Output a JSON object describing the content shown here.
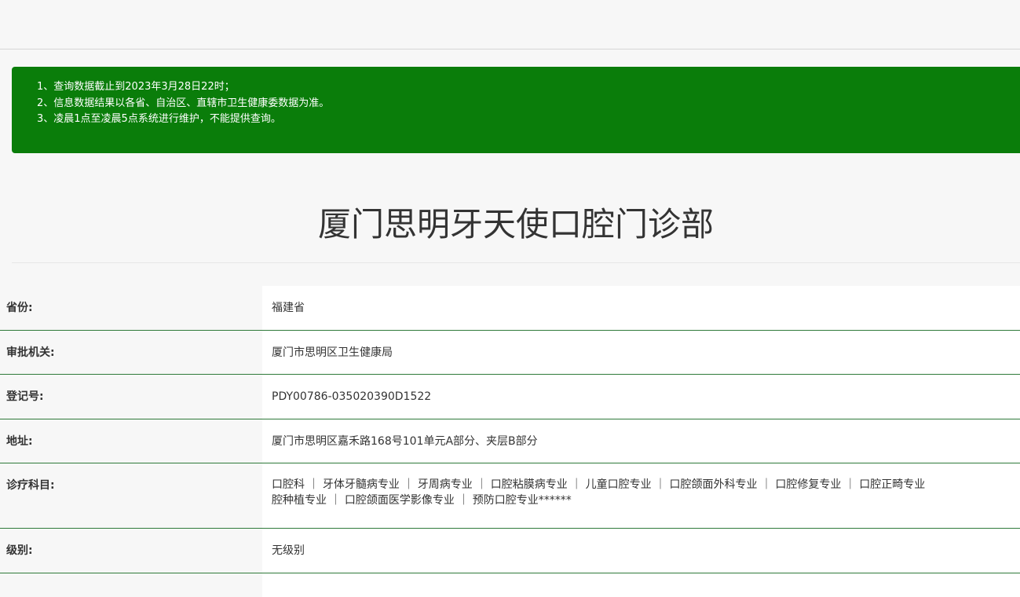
{
  "notice": {
    "lines": [
      "1、查询数据截止到2023年3月28日22时；",
      "2、信息数据结果以各省、自治区、直辖市卫生健康委数据为准。",
      "3、凌晨1点至凌晨5点系统进行维护，不能提供查询。"
    ],
    "background_color": "#0a7d0a"
  },
  "title": "厦门思明牙天使口腔门诊部",
  "details": {
    "province": {
      "label": "省份:",
      "value": "福建省"
    },
    "authority": {
      "label": "审批机关:",
      "value": "厦门市思明区卫生健康局"
    },
    "registration": {
      "label": "登记号:",
      "value": "PDY00786-035020390D1522"
    },
    "address": {
      "label": "地址:",
      "value": "厦门市思明区嘉禾路168号101单元A部分、夹层B部分"
    },
    "departments": {
      "label": "诊疗科目:",
      "line1": "口腔科 ｜ 牙体牙髓病专业 ｜ 牙周病专业 ｜ 口腔粘膜病专业 ｜ 儿童口腔专业 ｜ 口腔颌面外科专业 ｜ 口腔修复专业 ｜ 口腔正畸专业",
      "line2": "腔种植专业 ｜ 口腔颌面医学影像专业 ｜ 预防口腔专业******"
    },
    "level": {
      "label": "级别:",
      "value": "无级别"
    }
  },
  "colors": {
    "row_border": "#2f7a3a",
    "label_bg": "#f7f7f7",
    "value_bg": "#ffffff"
  }
}
